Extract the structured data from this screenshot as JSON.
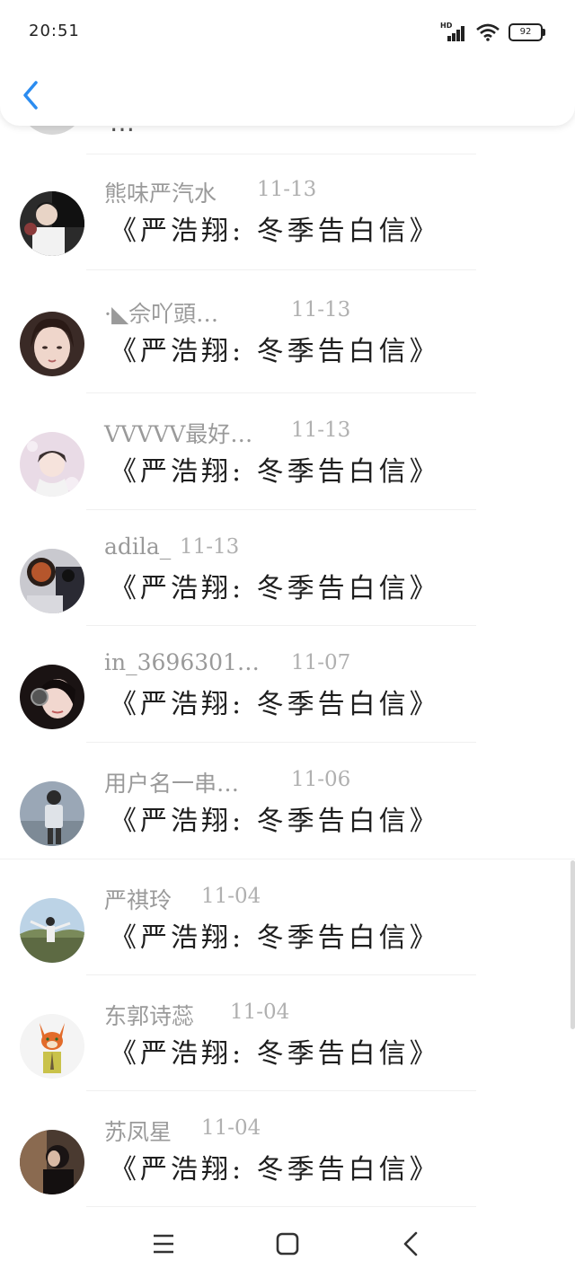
{
  "status_bar": {
    "time": "20:51",
    "network_label": "HD",
    "battery": "92"
  },
  "header": {
    "back_icon": "chevron-left-icon",
    "accent_color": "#2b8cf0"
  },
  "partial_item": {
    "message": "…"
  },
  "items": [
    {
      "name": "熊味严汽水",
      "date": "11-13",
      "message": "《严浩翔: 冬季告白信》"
    },
    {
      "name": "·◣佘吖頭…",
      "date": "11-13",
      "message": "《严浩翔: 冬季告白信》"
    },
    {
      "name": "VVVVV最好…",
      "date": "11-13",
      "message": "《严浩翔: 冬季告白信》"
    },
    {
      "name": "adila_",
      "date": "11-13",
      "message": "《严浩翔: 冬季告白信》"
    },
    {
      "name": "in_3696301…",
      "date": "11-07",
      "message": "《严浩翔: 冬季告白信》"
    },
    {
      "name": "用户名一串…",
      "date": "11-06",
      "message": "《严浩翔: 冬季告白信》"
    },
    {
      "name": "严祺玲",
      "date": "11-04",
      "message": "《严浩翔: 冬季告白信》"
    },
    {
      "name": "东郭诗蕊",
      "date": "11-04",
      "message": "《严浩翔: 冬季告白信》"
    },
    {
      "name": "苏凤星",
      "date": "11-04",
      "message": "《严浩翔: 冬季告白信》"
    }
  ],
  "nav_bar": {
    "icons": [
      "menu-icon",
      "home-square-icon",
      "back-triangle-icon"
    ]
  }
}
